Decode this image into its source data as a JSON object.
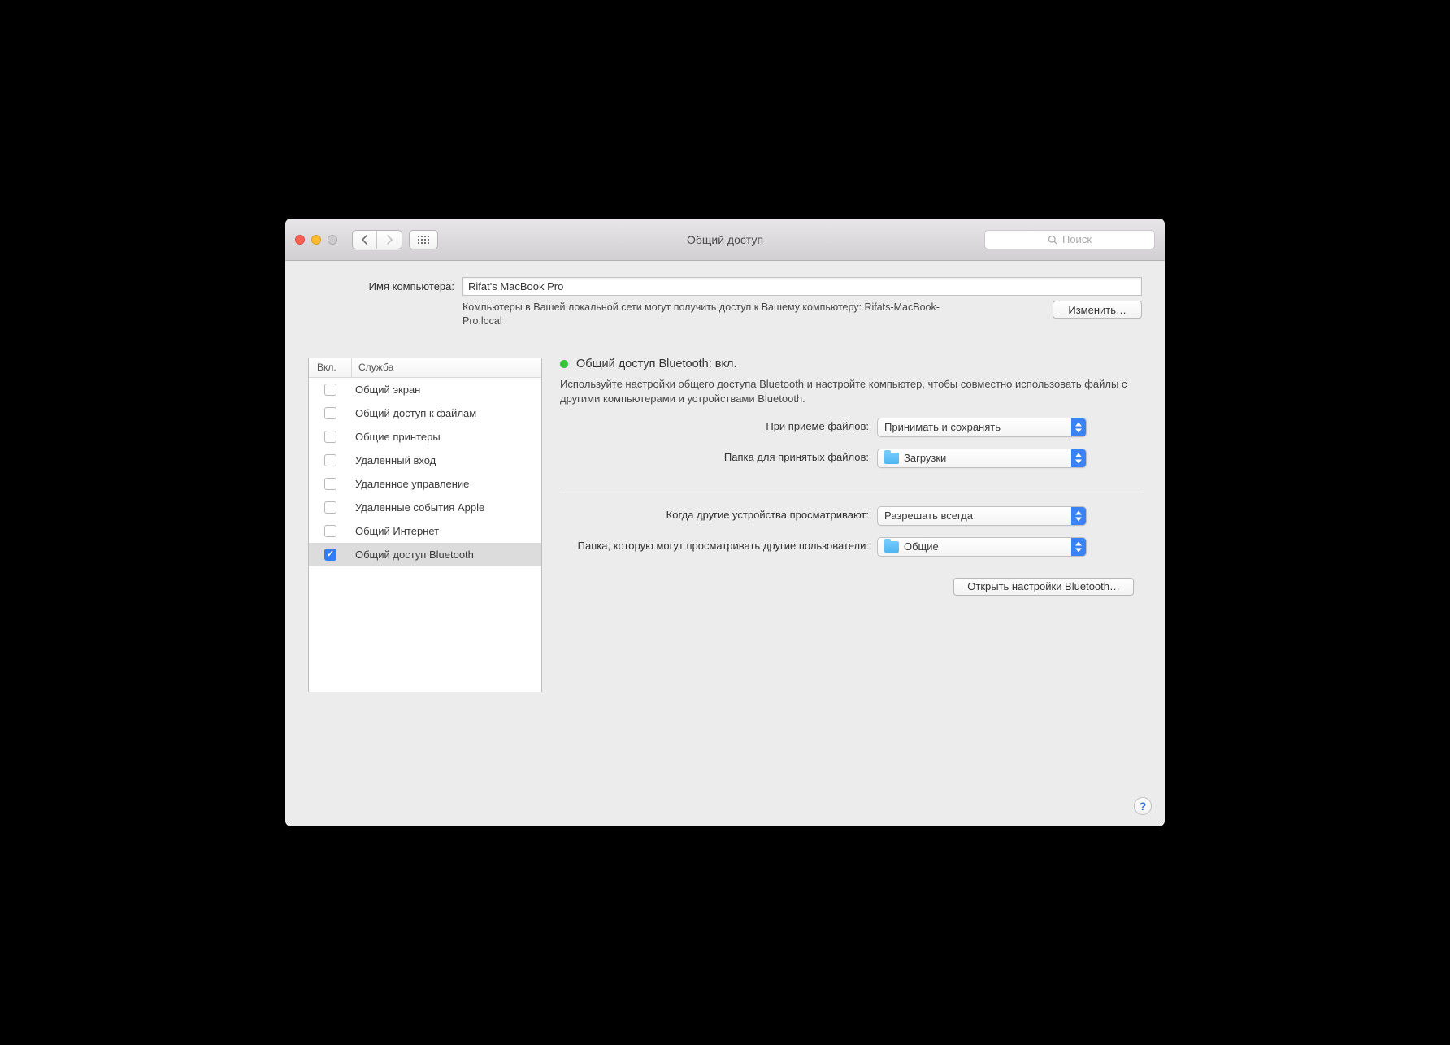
{
  "window": {
    "title": "Общий доступ"
  },
  "search": {
    "placeholder": "Поиск"
  },
  "computer_name": {
    "label": "Имя компьютера:",
    "value": "Rifat's MacBook Pro",
    "hint": "Компьютеры в Вашей локальной сети могут получить доступ к Вашему компьютеру: Rifats-MacBook-Pro.local",
    "edit_btn": "Изменить…"
  },
  "service_table": {
    "col_on": "Вкл.",
    "col_service": "Служба",
    "rows": [
      {
        "on": false,
        "name": "Общий экран"
      },
      {
        "on": false,
        "name": "Общий доступ к файлам"
      },
      {
        "on": false,
        "name": "Общие принтеры"
      },
      {
        "on": false,
        "name": "Удаленный вход"
      },
      {
        "on": false,
        "name": "Удаленное управление"
      },
      {
        "on": false,
        "name": "Удаленные события Apple"
      },
      {
        "on": false,
        "name": "Общий Интернет"
      },
      {
        "on": true,
        "name": "Общий доступ Bluetooth"
      }
    ]
  },
  "panel": {
    "status_title": "Общий доступ Bluetooth: вкл.",
    "description": "Используйте настройки общего доступа Bluetooth и настройте компьютер, чтобы совместно использовать файлы с другими компьютерами и устройствами Bluetooth.",
    "receive": {
      "label": "При приеме файлов:",
      "value": "Принимать и сохранять"
    },
    "folder_receive": {
      "label": "Папка для принятых файлов:",
      "value": "Загрузки"
    },
    "browse": {
      "label": "Когда другие устройства просматривают:",
      "value": "Разрешать всегда"
    },
    "folder_browse": {
      "label": "Папка, которую могут просматривать другие пользователи:",
      "value": "Общие"
    },
    "open_bt": "Открыть настройки Bluetooth…"
  },
  "help_glyph": "?"
}
